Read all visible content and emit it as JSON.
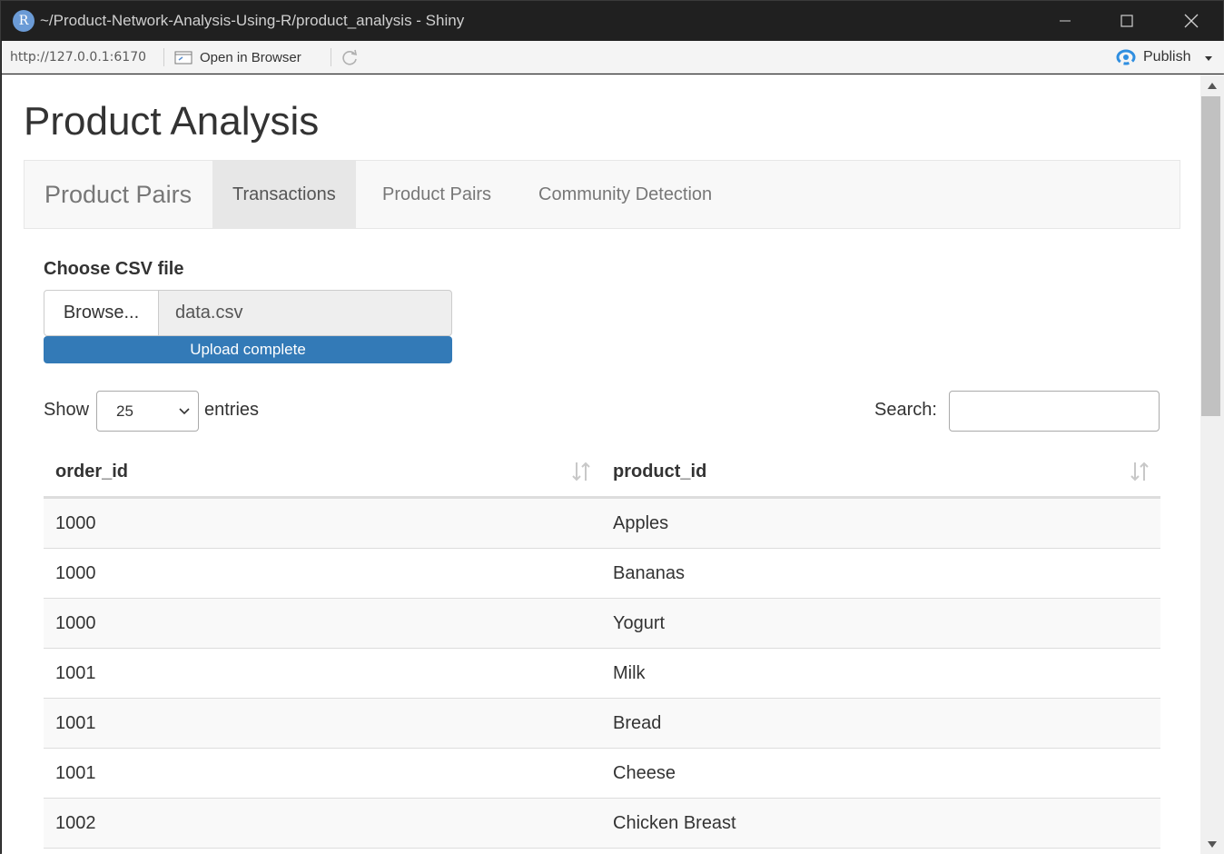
{
  "window": {
    "app_icon_letter": "R",
    "title": "~/Product-Network-Analysis-Using-R/product_analysis - Shiny"
  },
  "addressbar": {
    "url": "http://127.0.0.1:6170",
    "open_in_browser_label": "Open in Browser",
    "publish_label": "Publish"
  },
  "page": {
    "title": "Product Analysis"
  },
  "navbar": {
    "brand": "Product Pairs",
    "tabs": [
      {
        "label": "Transactions",
        "active": true
      },
      {
        "label": "Product Pairs",
        "active": false
      },
      {
        "label": "Community Detection",
        "active": false
      }
    ]
  },
  "file_input": {
    "label": "Choose CSV file",
    "browse_label": "Browse...",
    "filename": "data.csv",
    "progress_text": "Upload complete"
  },
  "table_controls": {
    "show_label": "Show",
    "entries_value": "25",
    "entries_label": "entries",
    "search_label": "Search:"
  },
  "table": {
    "columns": [
      "order_id",
      "product_id"
    ],
    "rows": [
      [
        "1000",
        "Apples"
      ],
      [
        "1000",
        "Bananas"
      ],
      [
        "1000",
        "Yogurt"
      ],
      [
        "1001",
        "Milk"
      ],
      [
        "1001",
        "Bread"
      ],
      [
        "1001",
        "Cheese"
      ],
      [
        "1002",
        "Chicken Breast"
      ]
    ]
  },
  "colors": {
    "progress": "#337ab7",
    "navbar_bg": "#f8f8f8",
    "active_tab_bg": "#e7e7e7",
    "titlebar_bg": "#202020"
  }
}
